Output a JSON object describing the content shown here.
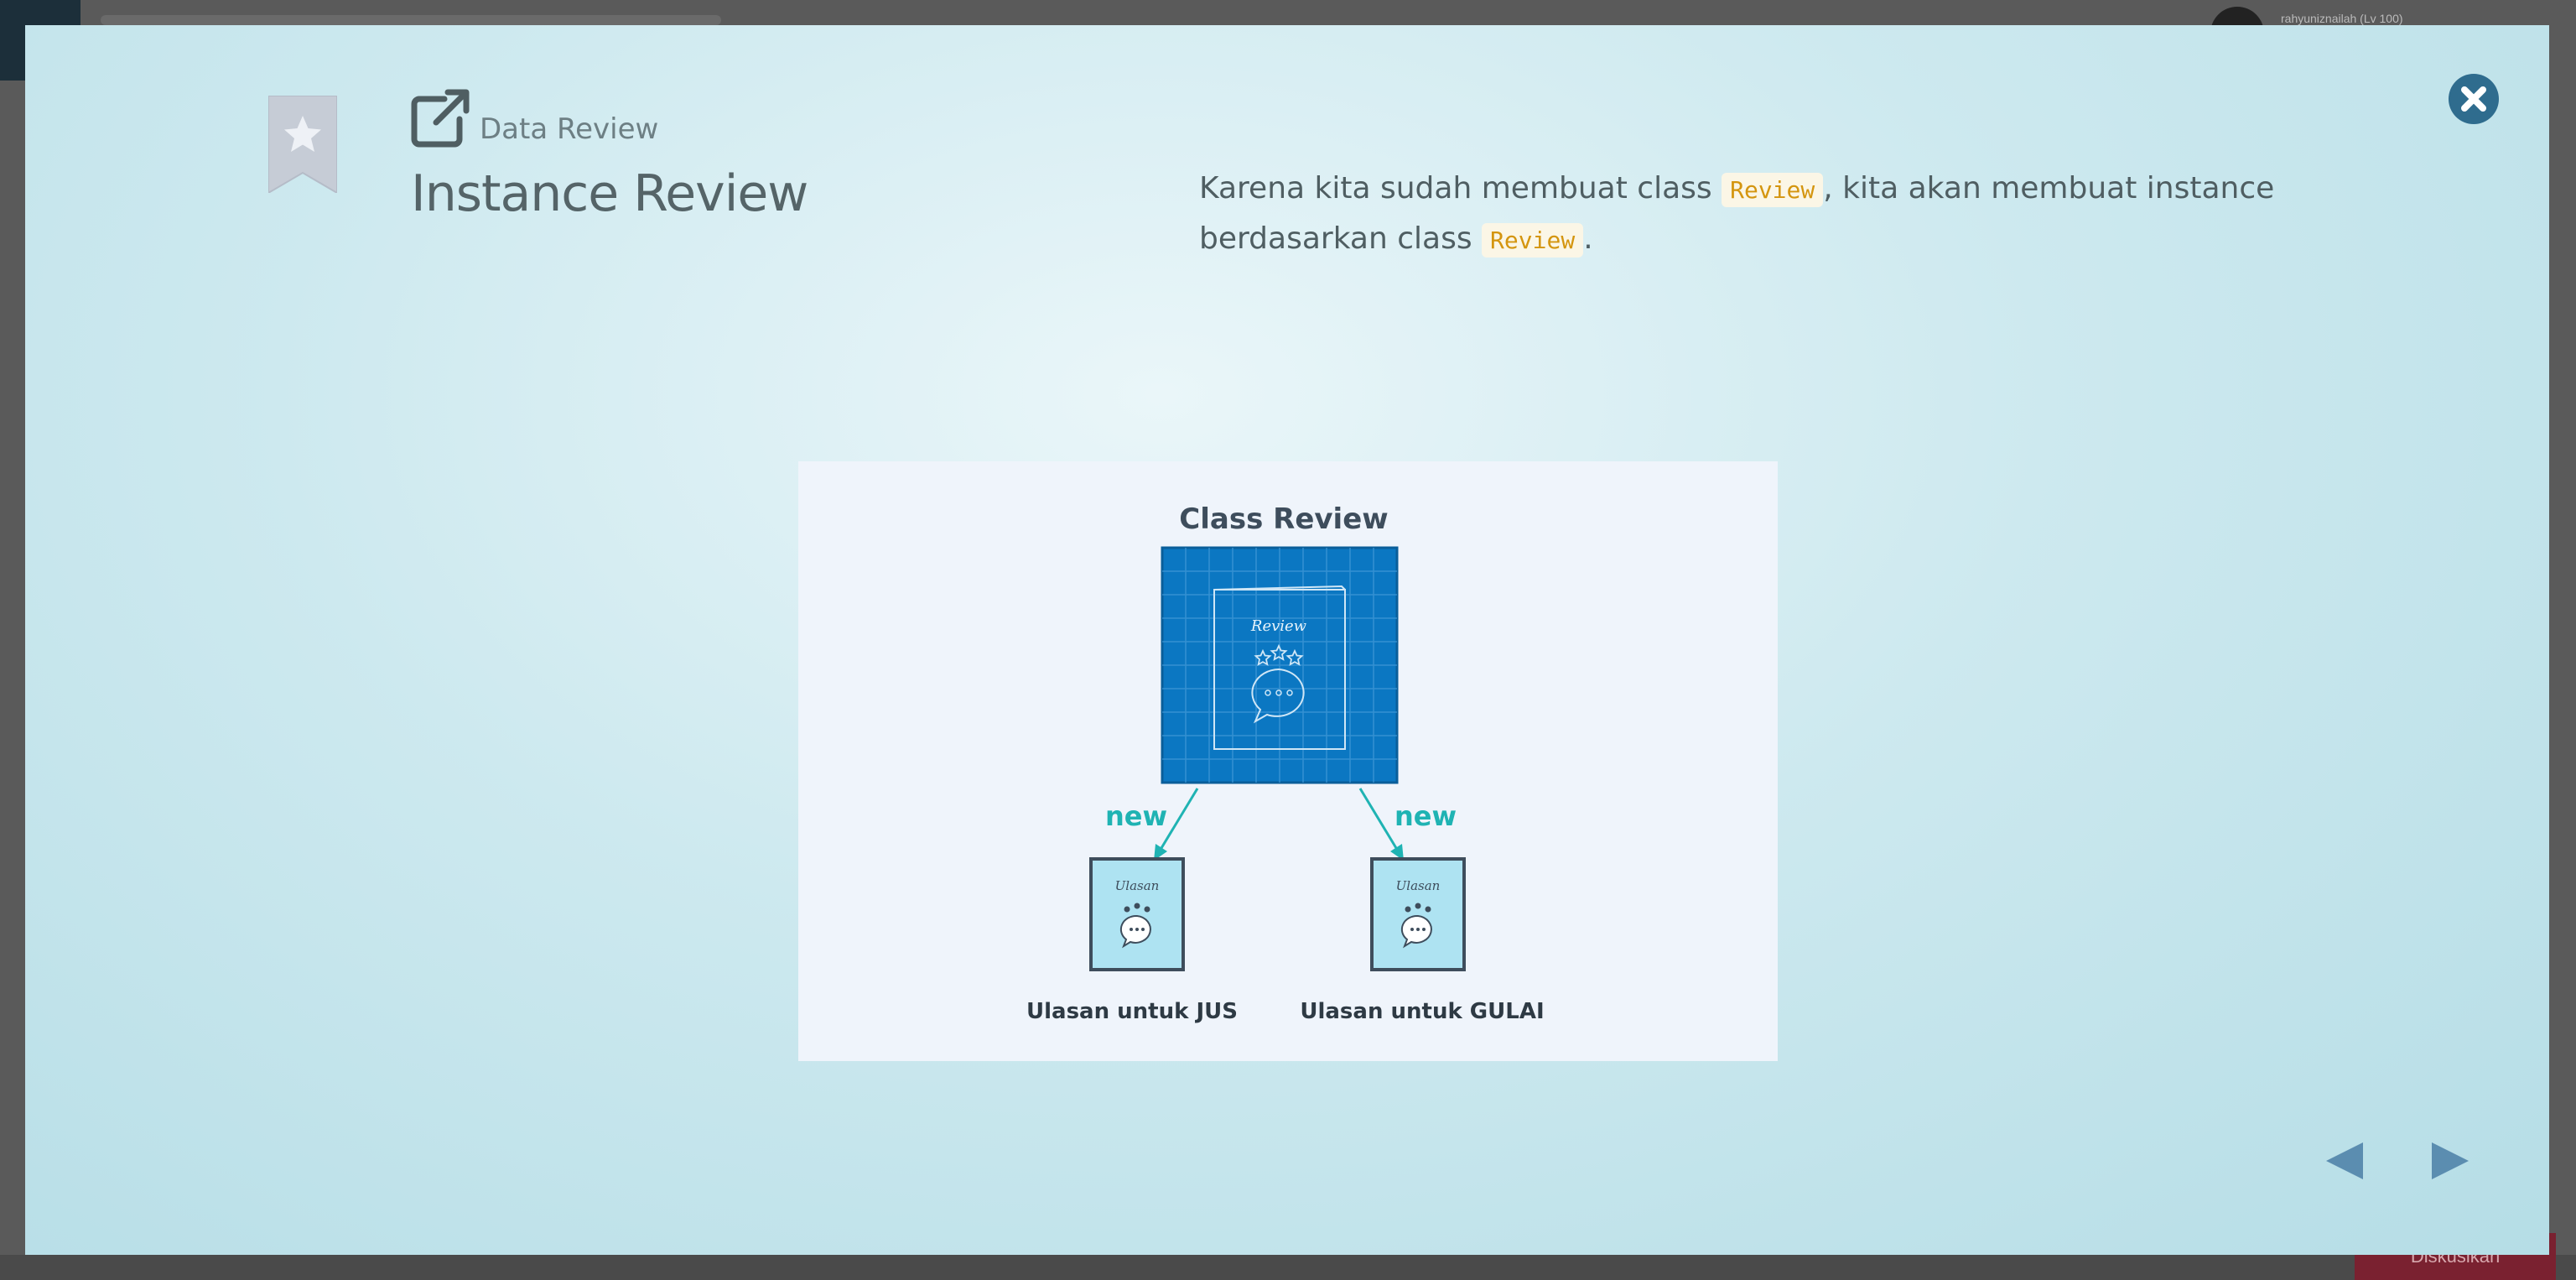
{
  "background": {
    "user_label": "rahyuniznailah (Lv 100)",
    "footer_button": "Diskusikan"
  },
  "modal": {
    "breadcrumb": "Data Review",
    "title": "Instance Review",
    "description": {
      "part1": "Karena kita sudah membuat class ",
      "code1": "Review",
      "part2": ", kita akan membuat instance berdasarkan class ",
      "code2": "Review",
      "part3": "."
    },
    "close_icon": "close-icon",
    "bookmark_icon": "bookmark-star-icon",
    "external_link_icon": "external-link-icon",
    "prev_icon": "triangle-left-icon",
    "next_icon": "triangle-right-icon"
  },
  "diagram": {
    "title": "Class Review",
    "class_card_label": "Review",
    "arrow_left_label": "new",
    "arrow_right_label": "new",
    "instance_left_card_label": "Ulasan",
    "instance_right_card_label": "Ulasan",
    "instance_left_caption": "Ulasan untuk JUS",
    "instance_right_caption": "Ulasan untuk GULAI"
  },
  "colors": {
    "accent": "#2f6c8e",
    "class_box": "#0b77c2",
    "instance_box": "#aee3f2",
    "arrow": "#1fb3b3",
    "code_text": "#d4950f"
  }
}
